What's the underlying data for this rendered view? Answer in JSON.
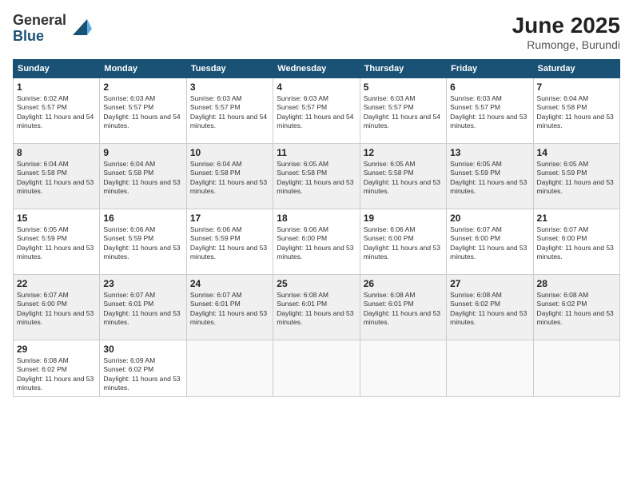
{
  "logo": {
    "general": "General",
    "blue": "Blue"
  },
  "header": {
    "month_year": "June 2025",
    "location": "Rumonge, Burundi"
  },
  "days_of_week": [
    "Sunday",
    "Monday",
    "Tuesday",
    "Wednesday",
    "Thursday",
    "Friday",
    "Saturday"
  ],
  "weeks": [
    [
      {
        "day": "1",
        "sunrise": "6:02 AM",
        "sunset": "5:57 PM",
        "daylight": "11 hours and 54 minutes."
      },
      {
        "day": "2",
        "sunrise": "6:03 AM",
        "sunset": "5:57 PM",
        "daylight": "11 hours and 54 minutes."
      },
      {
        "day": "3",
        "sunrise": "6:03 AM",
        "sunset": "5:57 PM",
        "daylight": "11 hours and 54 minutes."
      },
      {
        "day": "4",
        "sunrise": "6:03 AM",
        "sunset": "5:57 PM",
        "daylight": "11 hours and 54 minutes."
      },
      {
        "day": "5",
        "sunrise": "6:03 AM",
        "sunset": "5:57 PM",
        "daylight": "11 hours and 54 minutes."
      },
      {
        "day": "6",
        "sunrise": "6:03 AM",
        "sunset": "5:57 PM",
        "daylight": "11 hours and 53 minutes."
      },
      {
        "day": "7",
        "sunrise": "6:04 AM",
        "sunset": "5:58 PM",
        "daylight": "11 hours and 53 minutes."
      }
    ],
    [
      {
        "day": "8",
        "sunrise": "6:04 AM",
        "sunset": "5:58 PM",
        "daylight": "11 hours and 53 minutes."
      },
      {
        "day": "9",
        "sunrise": "6:04 AM",
        "sunset": "5:58 PM",
        "daylight": "11 hours and 53 minutes."
      },
      {
        "day": "10",
        "sunrise": "6:04 AM",
        "sunset": "5:58 PM",
        "daylight": "11 hours and 53 minutes."
      },
      {
        "day": "11",
        "sunrise": "6:05 AM",
        "sunset": "5:58 PM",
        "daylight": "11 hours and 53 minutes."
      },
      {
        "day": "12",
        "sunrise": "6:05 AM",
        "sunset": "5:58 PM",
        "daylight": "11 hours and 53 minutes."
      },
      {
        "day": "13",
        "sunrise": "6:05 AM",
        "sunset": "5:59 PM",
        "daylight": "11 hours and 53 minutes."
      },
      {
        "day": "14",
        "sunrise": "6:05 AM",
        "sunset": "5:59 PM",
        "daylight": "11 hours and 53 minutes."
      }
    ],
    [
      {
        "day": "15",
        "sunrise": "6:05 AM",
        "sunset": "5:59 PM",
        "daylight": "11 hours and 53 minutes."
      },
      {
        "day": "16",
        "sunrise": "6:06 AM",
        "sunset": "5:59 PM",
        "daylight": "11 hours and 53 minutes."
      },
      {
        "day": "17",
        "sunrise": "6:06 AM",
        "sunset": "5:59 PM",
        "daylight": "11 hours and 53 minutes."
      },
      {
        "day": "18",
        "sunrise": "6:06 AM",
        "sunset": "6:00 PM",
        "daylight": "11 hours and 53 minutes."
      },
      {
        "day": "19",
        "sunrise": "6:06 AM",
        "sunset": "6:00 PM",
        "daylight": "11 hours and 53 minutes."
      },
      {
        "day": "20",
        "sunrise": "6:07 AM",
        "sunset": "6:00 PM",
        "daylight": "11 hours and 53 minutes."
      },
      {
        "day": "21",
        "sunrise": "6:07 AM",
        "sunset": "6:00 PM",
        "daylight": "11 hours and 53 minutes."
      }
    ],
    [
      {
        "day": "22",
        "sunrise": "6:07 AM",
        "sunset": "6:00 PM",
        "daylight": "11 hours and 53 minutes."
      },
      {
        "day": "23",
        "sunrise": "6:07 AM",
        "sunset": "6:01 PM",
        "daylight": "11 hours and 53 minutes."
      },
      {
        "day": "24",
        "sunrise": "6:07 AM",
        "sunset": "6:01 PM",
        "daylight": "11 hours and 53 minutes."
      },
      {
        "day": "25",
        "sunrise": "6:08 AM",
        "sunset": "6:01 PM",
        "daylight": "11 hours and 53 minutes."
      },
      {
        "day": "26",
        "sunrise": "6:08 AM",
        "sunset": "6:01 PM",
        "daylight": "11 hours and 53 minutes."
      },
      {
        "day": "27",
        "sunrise": "6:08 AM",
        "sunset": "6:02 PM",
        "daylight": "11 hours and 53 minutes."
      },
      {
        "day": "28",
        "sunrise": "6:08 AM",
        "sunset": "6:02 PM",
        "daylight": "11 hours and 53 minutes."
      }
    ],
    [
      {
        "day": "29",
        "sunrise": "6:08 AM",
        "sunset": "6:02 PM",
        "daylight": "11 hours and 53 minutes."
      },
      {
        "day": "30",
        "sunrise": "6:09 AM",
        "sunset": "6:02 PM",
        "daylight": "11 hours and 53 minutes."
      },
      null,
      null,
      null,
      null,
      null
    ]
  ]
}
